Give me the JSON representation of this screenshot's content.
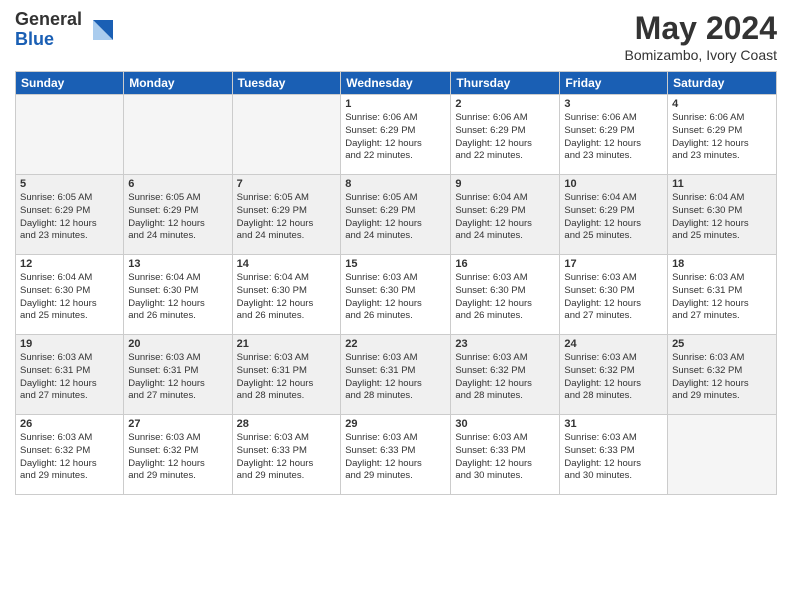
{
  "logo": {
    "general": "General",
    "blue": "Blue"
  },
  "title": "May 2024",
  "location": "Bomizambo, Ivory Coast",
  "days_of_week": [
    "Sunday",
    "Monday",
    "Tuesday",
    "Wednesday",
    "Thursday",
    "Friday",
    "Saturday"
  ],
  "weeks": [
    [
      {
        "day": "",
        "info": ""
      },
      {
        "day": "",
        "info": ""
      },
      {
        "day": "",
        "info": ""
      },
      {
        "day": "1",
        "info": "Sunrise: 6:06 AM\nSunset: 6:29 PM\nDaylight: 12 hours\nand 22 minutes."
      },
      {
        "day": "2",
        "info": "Sunrise: 6:06 AM\nSunset: 6:29 PM\nDaylight: 12 hours\nand 22 minutes."
      },
      {
        "day": "3",
        "info": "Sunrise: 6:06 AM\nSunset: 6:29 PM\nDaylight: 12 hours\nand 23 minutes."
      },
      {
        "day": "4",
        "info": "Sunrise: 6:06 AM\nSunset: 6:29 PM\nDaylight: 12 hours\nand 23 minutes."
      }
    ],
    [
      {
        "day": "5",
        "info": "Sunrise: 6:05 AM\nSunset: 6:29 PM\nDaylight: 12 hours\nand 23 minutes."
      },
      {
        "day": "6",
        "info": "Sunrise: 6:05 AM\nSunset: 6:29 PM\nDaylight: 12 hours\nand 24 minutes."
      },
      {
        "day": "7",
        "info": "Sunrise: 6:05 AM\nSunset: 6:29 PM\nDaylight: 12 hours\nand 24 minutes."
      },
      {
        "day": "8",
        "info": "Sunrise: 6:05 AM\nSunset: 6:29 PM\nDaylight: 12 hours\nand 24 minutes."
      },
      {
        "day": "9",
        "info": "Sunrise: 6:04 AM\nSunset: 6:29 PM\nDaylight: 12 hours\nand 24 minutes."
      },
      {
        "day": "10",
        "info": "Sunrise: 6:04 AM\nSunset: 6:29 PM\nDaylight: 12 hours\nand 25 minutes."
      },
      {
        "day": "11",
        "info": "Sunrise: 6:04 AM\nSunset: 6:30 PM\nDaylight: 12 hours\nand 25 minutes."
      }
    ],
    [
      {
        "day": "12",
        "info": "Sunrise: 6:04 AM\nSunset: 6:30 PM\nDaylight: 12 hours\nand 25 minutes."
      },
      {
        "day": "13",
        "info": "Sunrise: 6:04 AM\nSunset: 6:30 PM\nDaylight: 12 hours\nand 26 minutes."
      },
      {
        "day": "14",
        "info": "Sunrise: 6:04 AM\nSunset: 6:30 PM\nDaylight: 12 hours\nand 26 minutes."
      },
      {
        "day": "15",
        "info": "Sunrise: 6:03 AM\nSunset: 6:30 PM\nDaylight: 12 hours\nand 26 minutes."
      },
      {
        "day": "16",
        "info": "Sunrise: 6:03 AM\nSunset: 6:30 PM\nDaylight: 12 hours\nand 26 minutes."
      },
      {
        "day": "17",
        "info": "Sunrise: 6:03 AM\nSunset: 6:30 PM\nDaylight: 12 hours\nand 27 minutes."
      },
      {
        "day": "18",
        "info": "Sunrise: 6:03 AM\nSunset: 6:31 PM\nDaylight: 12 hours\nand 27 minutes."
      }
    ],
    [
      {
        "day": "19",
        "info": "Sunrise: 6:03 AM\nSunset: 6:31 PM\nDaylight: 12 hours\nand 27 minutes."
      },
      {
        "day": "20",
        "info": "Sunrise: 6:03 AM\nSunset: 6:31 PM\nDaylight: 12 hours\nand 27 minutes."
      },
      {
        "day": "21",
        "info": "Sunrise: 6:03 AM\nSunset: 6:31 PM\nDaylight: 12 hours\nand 28 minutes."
      },
      {
        "day": "22",
        "info": "Sunrise: 6:03 AM\nSunset: 6:31 PM\nDaylight: 12 hours\nand 28 minutes."
      },
      {
        "day": "23",
        "info": "Sunrise: 6:03 AM\nSunset: 6:32 PM\nDaylight: 12 hours\nand 28 minutes."
      },
      {
        "day": "24",
        "info": "Sunrise: 6:03 AM\nSunset: 6:32 PM\nDaylight: 12 hours\nand 28 minutes."
      },
      {
        "day": "25",
        "info": "Sunrise: 6:03 AM\nSunset: 6:32 PM\nDaylight: 12 hours\nand 29 minutes."
      }
    ],
    [
      {
        "day": "26",
        "info": "Sunrise: 6:03 AM\nSunset: 6:32 PM\nDaylight: 12 hours\nand 29 minutes."
      },
      {
        "day": "27",
        "info": "Sunrise: 6:03 AM\nSunset: 6:32 PM\nDaylight: 12 hours\nand 29 minutes."
      },
      {
        "day": "28",
        "info": "Sunrise: 6:03 AM\nSunset: 6:33 PM\nDaylight: 12 hours\nand 29 minutes."
      },
      {
        "day": "29",
        "info": "Sunrise: 6:03 AM\nSunset: 6:33 PM\nDaylight: 12 hours\nand 29 minutes."
      },
      {
        "day": "30",
        "info": "Sunrise: 6:03 AM\nSunset: 6:33 PM\nDaylight: 12 hours\nand 30 minutes."
      },
      {
        "day": "31",
        "info": "Sunrise: 6:03 AM\nSunset: 6:33 PM\nDaylight: 12 hours\nand 30 minutes."
      },
      {
        "day": "",
        "info": ""
      }
    ]
  ]
}
